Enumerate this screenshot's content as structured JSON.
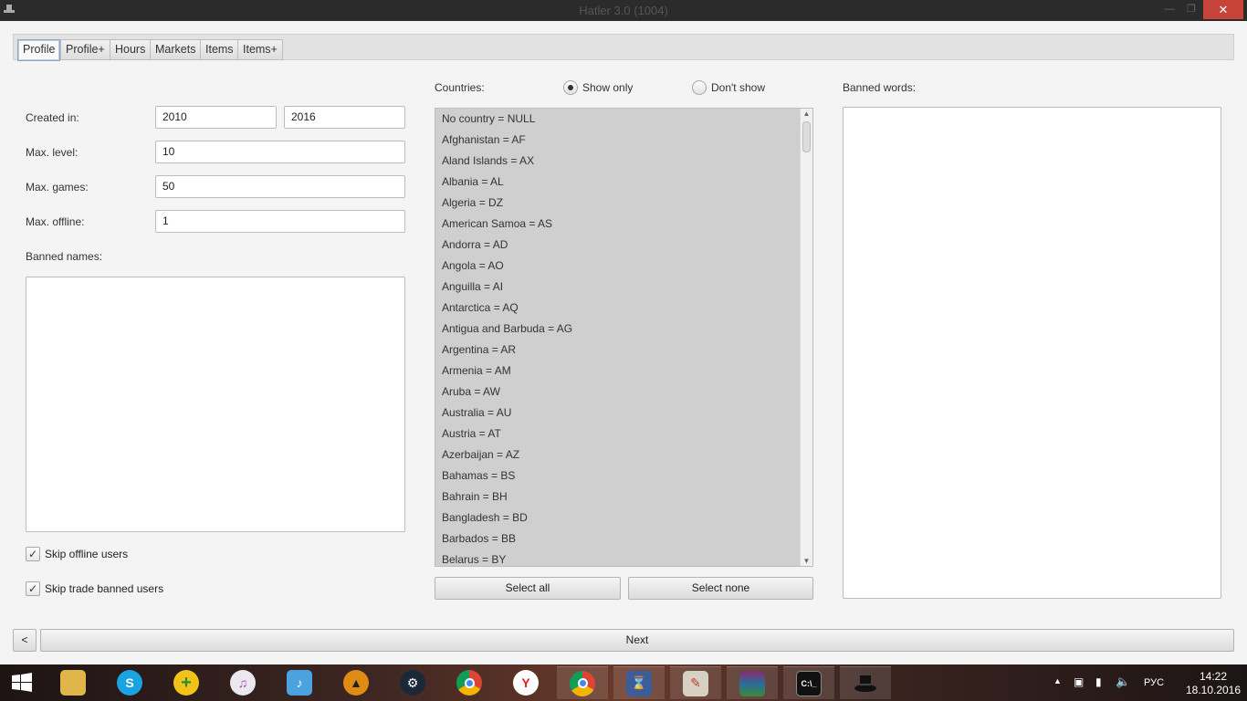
{
  "window": {
    "title": "Hatler 3.0 (1004)",
    "min": "—",
    "max": "❐",
    "close": "✕"
  },
  "tabs": [
    {
      "label": "Profile",
      "active": true
    },
    {
      "label": "Profile+"
    },
    {
      "label": "Hours"
    },
    {
      "label": "Markets"
    },
    {
      "label": "Items"
    },
    {
      "label": "Items+"
    }
  ],
  "profile": {
    "created_label": "Created in:",
    "created_from": "2010",
    "created_to": "2016",
    "max_level_label": "Max. level:",
    "max_level": "10",
    "max_games_label": "Max. games:",
    "max_games": "50",
    "max_offline_label": "Max. offline:",
    "max_offline": "1",
    "banned_names_label": "Banned names:",
    "skip_offline_label": "Skip offline users",
    "skip_offline_checked": true,
    "skip_trade_banned_label": "Skip trade banned users",
    "skip_trade_banned_checked": true
  },
  "countries": {
    "label": "Countries:",
    "show_only_label": "Show only",
    "dont_show_label": "Don't show",
    "mode": "show_only",
    "items": [
      "No country = NULL",
      "Afghanistan = AF",
      "Aland Islands = AX",
      "Albania = AL",
      "Algeria = DZ",
      "American Samoa = AS",
      "Andorra = AD",
      "Angola = AO",
      "Anguilla = AI",
      "Antarctica = AQ",
      "Antigua and Barbuda = AG",
      "Argentina = AR",
      "Armenia = AM",
      "Aruba = AW",
      "Australia = AU",
      "Austria = AT",
      "Azerbaijan = AZ",
      "Bahamas = BS",
      "Bahrain = BH",
      "Bangladesh = BD",
      "Barbados = BB",
      "Belarus = BY"
    ],
    "select_all_label": "Select all",
    "select_none_label": "Select none"
  },
  "banned_words_label": "Banned words:",
  "footer": {
    "back_label": "<",
    "next_label": "Next"
  },
  "taskbar": {
    "icons": [
      "windows-start-icon",
      "file-explorer-icon",
      "skype-icon",
      "plus-app-icon",
      "itunes-icon",
      "music-app-icon",
      "avast-icon",
      "steam-icon",
      "chrome-icon",
      "yandex-browser-icon",
      "chrome-icon",
      "hourglass-app-icon",
      "paint-icon",
      "winrar-icon",
      "cmd-icon",
      "hatler-app-icon"
    ],
    "lang": "РУС",
    "time": "14:22",
    "date": "18.10.2016"
  }
}
